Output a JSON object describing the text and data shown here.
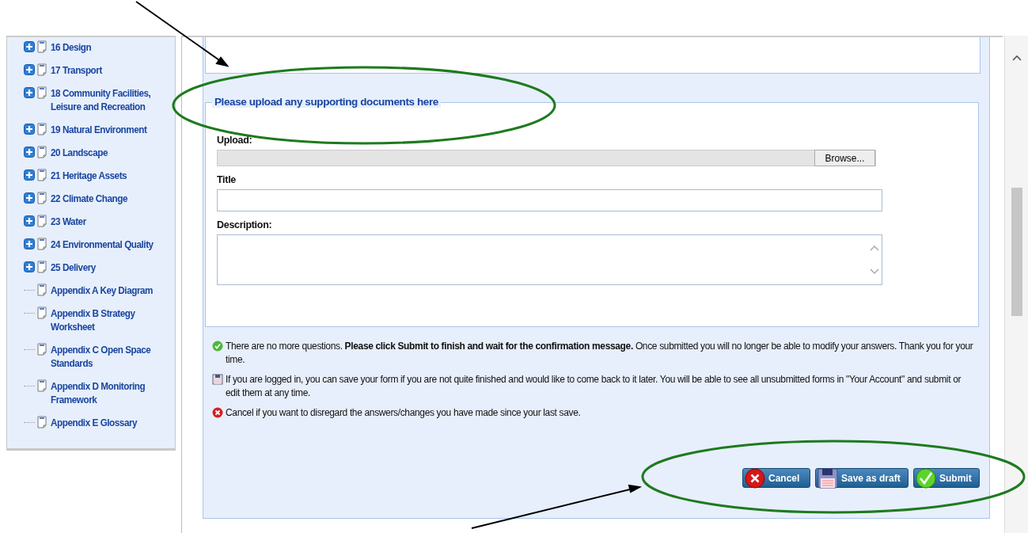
{
  "sidebar": {
    "items": [
      {
        "kind": "section",
        "label": "16 Design"
      },
      {
        "kind": "section",
        "label": "17 Transport"
      },
      {
        "kind": "section",
        "label": "18 Community Facilities, Leisure and Recreation"
      },
      {
        "kind": "section",
        "label": "19 Natural Environment"
      },
      {
        "kind": "section",
        "label": "20 Landscape"
      },
      {
        "kind": "section",
        "label": "21 Heritage Assets"
      },
      {
        "kind": "section",
        "label": "22 Climate Change"
      },
      {
        "kind": "section",
        "label": "23 Water"
      },
      {
        "kind": "section",
        "label": "24 Environmental Quality"
      },
      {
        "kind": "section",
        "label": "25 Delivery"
      },
      {
        "kind": "leaf",
        "label": "Appendix A Key Diagram"
      },
      {
        "kind": "leaf",
        "label": "Appendix B Strategy Worksheet"
      },
      {
        "kind": "leaf",
        "label": "Appendix C Open Space Standards"
      },
      {
        "kind": "leaf",
        "label": "Appendix D Monitoring Framework"
      },
      {
        "kind": "leaf",
        "label": "Appendix E Glossary"
      }
    ]
  },
  "upload_section": {
    "legend": "Please upload any supporting documents here",
    "upload_label": "Upload:",
    "browse_button": "Browse...",
    "title_label": "Title",
    "description_label": "Description:"
  },
  "messages": [
    {
      "kind": "ok",
      "text": "There are no more questions. **Please click Submit to finish and wait for the confirmation message.** Once submitted you will no longer be able to modify your answers. Thank you for your time."
    },
    {
      "kind": "save",
      "text": "If you are logged in, you can save your form if you are not quite finished and would like to come back to it later. You will be able to see all unsubmitted forms in \"Your Account\" and submit or edit them at any time."
    },
    {
      "kind": "cancel",
      "text": "Cancel if you want to disregard the answers/changes you have made since your last save."
    }
  ],
  "buttons": [
    {
      "kind": "cancel",
      "label": "Cancel"
    },
    {
      "kind": "save",
      "label": "Save as draft"
    },
    {
      "kind": "ok",
      "label": "Submit"
    }
  ]
}
